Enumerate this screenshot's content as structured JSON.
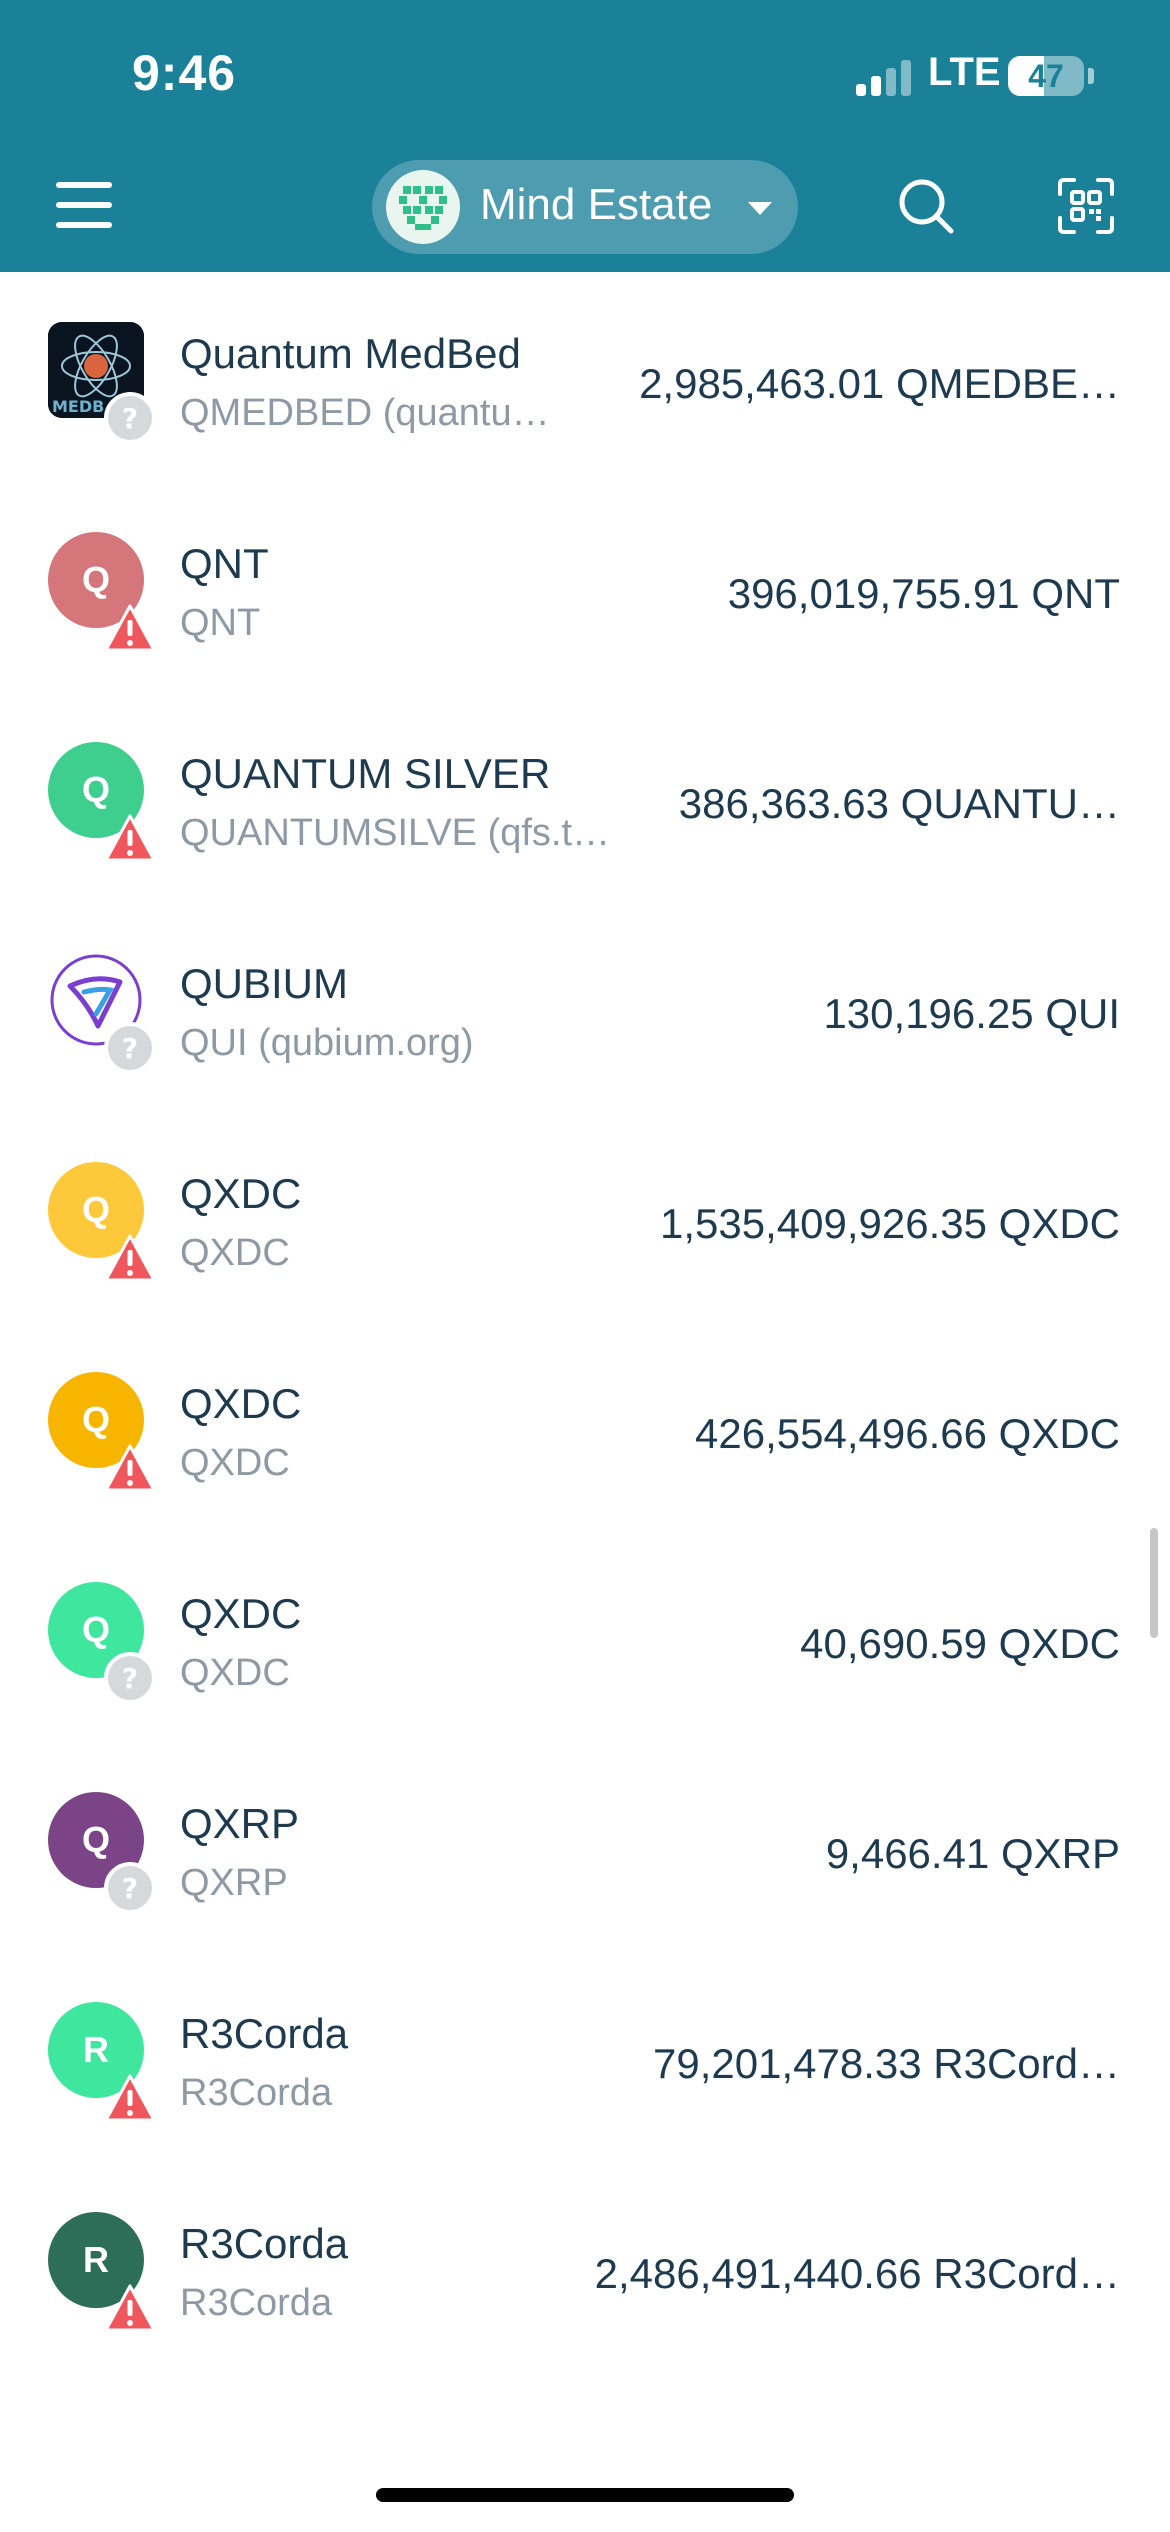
{
  "status_bar": {
    "time": "9:46",
    "network": "LTE",
    "battery": "47",
    "battery_level": 0.47
  },
  "header": {
    "wallet_name": "Mind Estate"
  },
  "assets": [
    {
      "name": "Quantum MedBed",
      "subtitle": "QMEDBED (quantu…",
      "amount": "2,985,463.01 QMEDBE…",
      "icon_letter": "",
      "icon_color": "#0a1420",
      "badge": "unknown"
    },
    {
      "name": "QNT",
      "subtitle": "QNT",
      "amount": "396,019,755.91 QNT",
      "icon_letter": "Q",
      "icon_color": "#d4767a",
      "badge": "warning"
    },
    {
      "name": "QUANTUM SILVER",
      "subtitle": "QUANTUMSILVE (qfs.t…",
      "amount": "386,363.63 QUANTU…",
      "icon_letter": "Q",
      "icon_color": "#3ecf8e",
      "badge": "warning"
    },
    {
      "name": "QUBIUM",
      "subtitle": "QUI (qubium.org)",
      "amount": "130,196.25 QUI",
      "icon_letter": "",
      "icon_color": "#ffffff",
      "badge": "unknown"
    },
    {
      "name": "QXDC",
      "subtitle": "QXDC",
      "amount": "1,535,409,926.35 QXDC",
      "icon_letter": "Q",
      "icon_color": "#fdc93a",
      "badge": "warning"
    },
    {
      "name": "QXDC",
      "subtitle": "QXDC",
      "amount": "426,554,496.66 QXDC",
      "icon_letter": "Q",
      "icon_color": "#f7b500",
      "badge": "warning"
    },
    {
      "name": "QXDC",
      "subtitle": "QXDC",
      "amount": "40,690.59 QXDC",
      "icon_letter": "Q",
      "icon_color": "#3ee69e",
      "badge": "unknown"
    },
    {
      "name": "QXRP",
      "subtitle": "QXRP",
      "amount": "9,466.41 QXRP",
      "icon_letter": "Q",
      "icon_color": "#7b4486",
      "badge": "unknown"
    },
    {
      "name": "R3Corda",
      "subtitle": "R3Corda",
      "amount": "79,201,478.33 R3Cord…",
      "icon_letter": "R",
      "icon_color": "#3ee69e",
      "badge": "warning"
    },
    {
      "name": "R3Corda",
      "subtitle": "R3Corda",
      "amount": "2,486,491,440.66 R3Cord…",
      "icon_letter": "R",
      "icon_color": "#2d6e58",
      "badge": "warning"
    }
  ]
}
